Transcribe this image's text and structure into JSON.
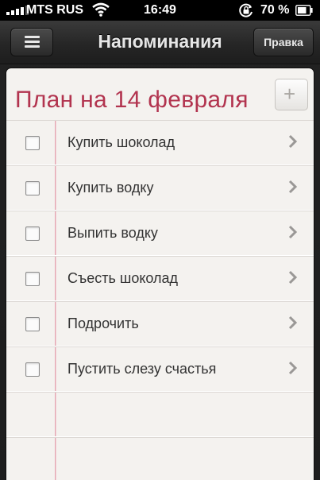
{
  "status_bar": {
    "carrier": "MTS RUS",
    "time": "16:49",
    "battery": "70 %"
  },
  "nav": {
    "title": "Напоминания",
    "edit_label": "Правка"
  },
  "list": {
    "title": "План на 14 февраля",
    "add_symbol": "+",
    "items": [
      {
        "label": "Купить шоколад",
        "checked": false
      },
      {
        "label": "Купить водку",
        "checked": false
      },
      {
        "label": "Выпить водку",
        "checked": false
      },
      {
        "label": "Съесть шоколад",
        "checked": false
      },
      {
        "label": "Подрочить",
        "checked": false
      },
      {
        "label": "Пустить слезу счастья",
        "checked": false
      }
    ]
  },
  "colors": {
    "title_accent": "#b2344f",
    "paper": "#f4f2ef",
    "navbar": "#262626"
  },
  "icons": {
    "menu": "hamburger-icon",
    "add": "plus-icon",
    "row_disclosure": "chevron-right-icon"
  }
}
